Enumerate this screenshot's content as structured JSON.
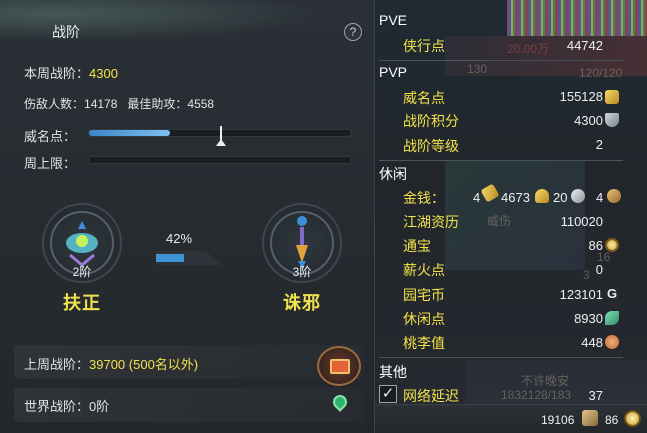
{
  "left": {
    "title": "战阶",
    "help": "?",
    "weekly": {
      "label": "本周战阶：",
      "value": "4300"
    },
    "enemies": {
      "label": "伤敌人数：",
      "value": "14178"
    },
    "assist": {
      "label": "最佳助攻：",
      "value": "4558"
    },
    "prestige_label": "威名点：",
    "prestige_progress": 0.31,
    "weekly_cap_label": "周上限：",
    "left_emblem": {
      "tier": "2阶",
      "name": "扶正"
    },
    "right_emblem": {
      "tier": "3阶",
      "name": "诛邪"
    },
    "percent": "42%",
    "percent_value": 0.42,
    "last_week": {
      "label": "上周战阶：",
      "value": "39700 (500名以外)"
    },
    "world": {
      "label": "世界战阶：",
      "value": "0阶"
    }
  },
  "right": {
    "pve_title": "PVE",
    "pve_items": [
      {
        "label": "侠行点",
        "value": "44742"
      }
    ],
    "pvp_title": "PVP",
    "pvp_items": [
      {
        "label": "威名点",
        "value": "155128"
      },
      {
        "label": "战阶积分",
        "value": "4300"
      },
      {
        "label": "战阶等级",
        "value": "2"
      }
    ],
    "leisure_title": "休闲",
    "money": {
      "label": "金钱：",
      "v1": "4",
      "v2": "4673",
      "v3": "20",
      "v4": "4"
    },
    "leisure_items": [
      {
        "label": "江湖资历",
        "value": "110020"
      },
      {
        "label": "通宝",
        "value": "86"
      },
      {
        "label": "薪火点",
        "value": "0"
      },
      {
        "label": "园宅币",
        "value": "123101"
      },
      {
        "label": "休闲点",
        "value": "8930"
      },
      {
        "label": "桃李值",
        "value": "448"
      }
    ],
    "other_title": "其他",
    "latency": {
      "label": "网络延迟",
      "value": "37"
    },
    "bottom": {
      "left": "19106",
      "right": "86"
    },
    "ghost_texts": {
      "a": "20.00万",
      "b": "130",
      "c": "120/120",
      "d": "威伤",
      "e": "不许晚安",
      "f": "1832128/183",
      "g": "16",
      "h": "3"
    }
  }
}
